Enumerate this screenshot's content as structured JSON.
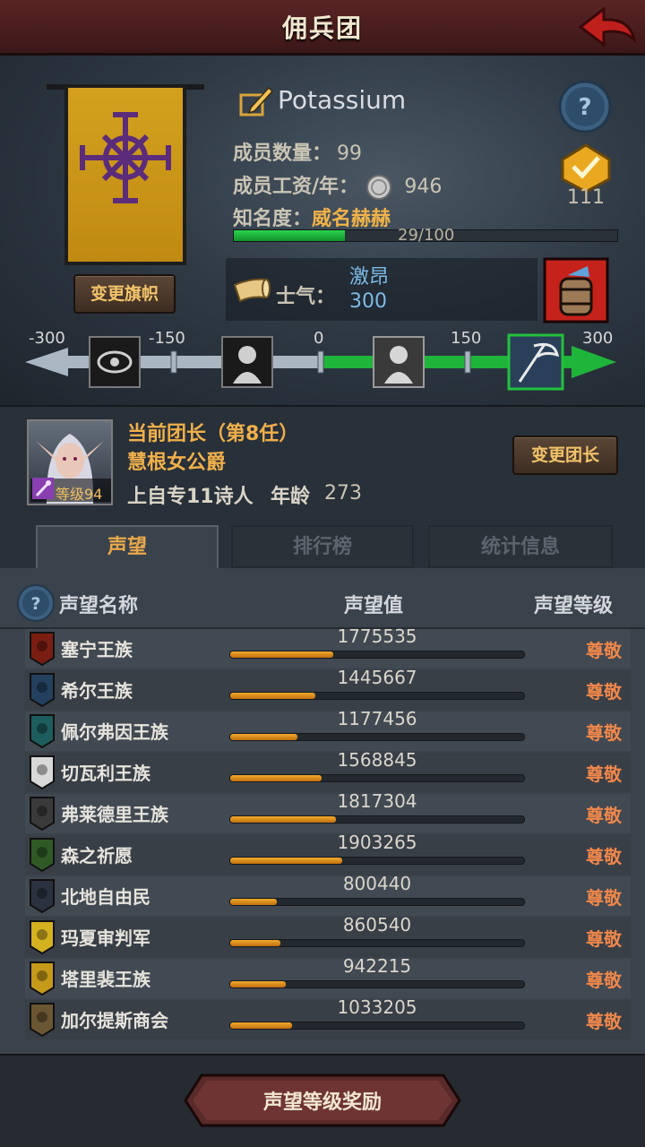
{
  "header": {
    "title": "佣兵团"
  },
  "guild": {
    "name": "Potassium",
    "members_label": "成员数量：",
    "members_value": "99",
    "salary_label": "成员工资/年：",
    "salary_value": "946",
    "fame_label": "知名度：",
    "fame_value": "威名赫赫",
    "fame_progress_text": "29/100",
    "fame_progress": 0.29,
    "change_banner_label": "变更旗帜",
    "badge_count": "111"
  },
  "morale": {
    "label": "士气：",
    "state": "激昂",
    "value": "300",
    "scale_ticks": [
      "-300",
      "-150",
      "0",
      "150",
      "300"
    ],
    "level": 300
  },
  "leader": {
    "title": "当前团长（第8任）",
    "name": "慧根女公爵",
    "level": "等级94",
    "class_text": "上自专11诗人",
    "age_label": "年龄",
    "age": "273",
    "change_leader_label": "变更团长"
  },
  "tabs": [
    {
      "label": "声望",
      "active": true
    },
    {
      "label": "排行榜",
      "active": false
    },
    {
      "label": "统计信息",
      "active": false
    }
  ],
  "table": {
    "headers": [
      "声望名称",
      "声望值",
      "声望等级"
    ],
    "rows": [
      {
        "name": "塞宁王族",
        "value": "1775535",
        "rank": "尊敬",
        "progress": 0.35,
        "crest_color": "#7a1e14",
        "icon": "crest-red-icon"
      },
      {
        "name": "希尔王族",
        "value": "1445667",
        "rank": "尊敬",
        "progress": 0.29,
        "crest_color": "#23415e",
        "icon": "crest-blue-icon"
      },
      {
        "name": "佩尔弗因王族",
        "value": "1177456",
        "rank": "尊敬",
        "progress": 0.23,
        "crest_color": "#1d5d5d",
        "icon": "crest-teal-icon"
      },
      {
        "name": "切瓦利王族",
        "value": "1568845",
        "rank": "尊敬",
        "progress": 0.31,
        "crest_color": "#d8d8d8",
        "icon": "crest-white-icon"
      },
      {
        "name": "弗莱德里王族",
        "value": "1817304",
        "rank": "尊敬",
        "progress": 0.36,
        "crest_color": "#3a3a3a",
        "icon": "crest-dark-icon"
      },
      {
        "name": "森之祈愿",
        "value": "1903265",
        "rank": "尊敬",
        "progress": 0.38,
        "crest_color": "#2f5a26",
        "icon": "crest-tree-icon"
      },
      {
        "name": "北地自由民",
        "value": "800440",
        "rank": "尊敬",
        "progress": 0.16,
        "crest_color": "#2a3240",
        "icon": "crest-axe-icon"
      },
      {
        "name": "玛夏审判军",
        "value": "860540",
        "rank": "尊敬",
        "progress": 0.17,
        "crest_color": "#d4b11f",
        "icon": "crest-gold-icon"
      },
      {
        "name": "塔里裴王族",
        "value": "942215",
        "rank": "尊敬",
        "progress": 0.19,
        "crest_color": "#c59a1a",
        "icon": "crest-crown-icon"
      },
      {
        "name": "加尔提斯商会",
        "value": "1033205",
        "rank": "尊敬",
        "progress": 0.21,
        "crest_color": "#6b5634",
        "icon": "crest-chest-icon"
      }
    ]
  },
  "footer": {
    "reward_button_label": "声望等级奖励"
  }
}
